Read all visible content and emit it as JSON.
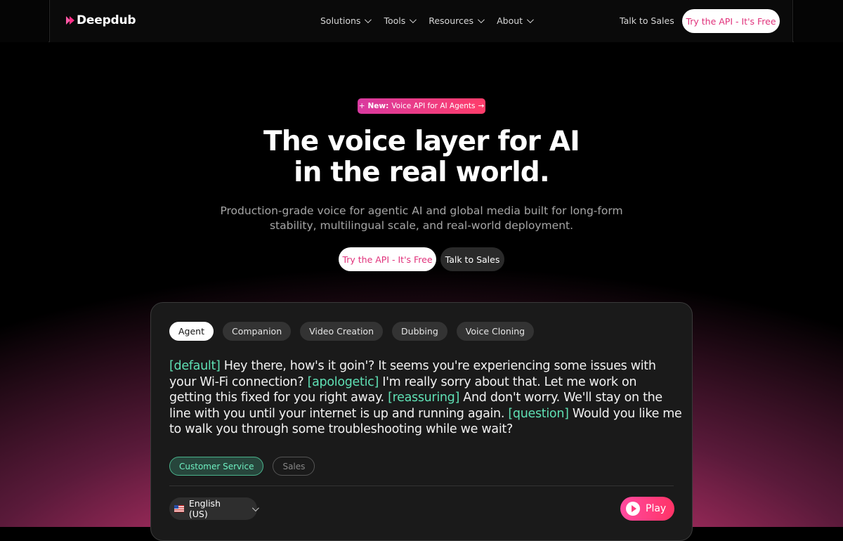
{
  "nav": {
    "logo": "Deepdub",
    "menu": [
      "Solutions",
      "Tools",
      "Resources",
      "About"
    ],
    "talk_to_sales": "Talk to Sales",
    "cta": "Try the API - It's Free"
  },
  "hero": {
    "badge_new": "New:",
    "badge_text": "Voice API for AI Agents",
    "badge_arrow": "→",
    "badge_plus": "+",
    "title_line1": "The voice layer for AI",
    "title_line2": "in the real world.",
    "subtitle_line1": "Production-grade voice for agentic AI and global media built for long-form",
    "subtitle_line2": "stability, multilingual scale, and real-world deployment.",
    "primary_button": "Try the API - It's Free",
    "secondary_button": "Talk to Sales"
  },
  "demo": {
    "tabs": [
      "Agent",
      "Companion",
      "Video Creation",
      "Dubbing",
      "Voice Cloning"
    ],
    "active_tab": "Agent",
    "segments": [
      {
        "tag": "[default]",
        "text": " Hey there, how's it goin'? It seems you're experiencing some issues with your Wi-Fi connection? "
      },
      {
        "tag": "[apologetic]",
        "text": " I'm really sorry about that. Let me work on getting this fixed for you right away. "
      },
      {
        "tag": "[reassuring]",
        "text": " And don't worry. We'll stay on the line with you until your internet is up and running again. "
      },
      {
        "tag": "[question]",
        "text": " Would you like me to walk you through some troubleshooting while we wait?"
      }
    ],
    "chips": [
      "Customer Service",
      "Sales"
    ],
    "active_chip": "Customer Service",
    "language": "English (US)",
    "play_label": "Play"
  },
  "colors": {
    "accent_pink": "#ff3d7f",
    "tag_green": "#5fe0b4",
    "card_bg": "#1a1a1a"
  }
}
